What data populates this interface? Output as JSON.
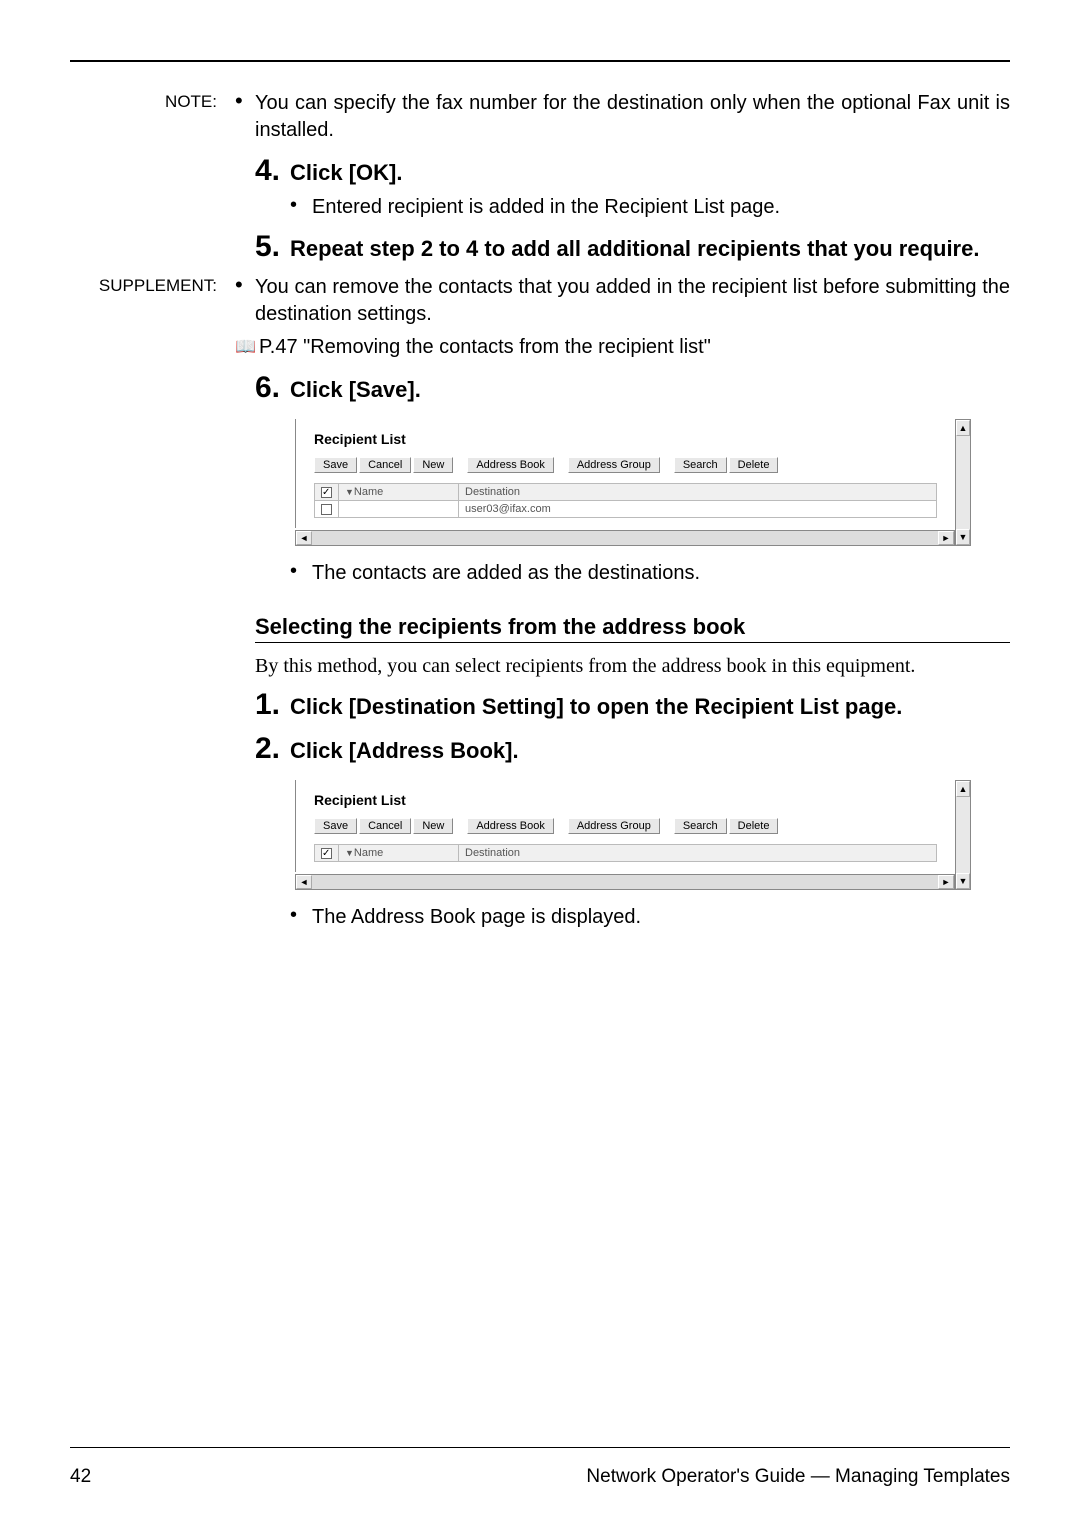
{
  "note_label": "NOTE:",
  "note_text": "You can specify the fax number for the destination only when the optional Fax unit is installed.",
  "step4": {
    "num": "4.",
    "text": "Click [OK]."
  },
  "step4_sub": "Entered recipient is added in the Recipient List page.",
  "step5": {
    "num": "5.",
    "text": "Repeat step 2 to 4 to add all additional recipients that you require."
  },
  "supp_label": "SUPPLEMENT:",
  "supp_text": "You can remove the contacts that you added in the recipient list before submitting the destination settings.",
  "supp_ref": "P.47 \"Removing the contacts from the recipient list\"",
  "step6": {
    "num": "6.",
    "text": "Click [Save]."
  },
  "step6_sub": "The contacts are added as the destinations.",
  "shot1": {
    "title": "Recipient List",
    "buttons": [
      "Save",
      "Cancel",
      "New",
      "Address Book",
      "Address Group",
      "Search",
      "Delete"
    ],
    "cols": [
      "Name",
      "Destination"
    ],
    "row_dest": "user03@ifax.com"
  },
  "heading3": "Selecting the recipients from the address book",
  "body1": "By this method, you can select recipients from the address book in this equipment.",
  "step1b": {
    "num": "1.",
    "text": "Click [Destination Setting] to open the Recipient List page."
  },
  "step2b": {
    "num": "2.",
    "text": "Click [Address Book]."
  },
  "shot2": {
    "title": "Recipient List",
    "buttons": [
      "Save",
      "Cancel",
      "New",
      "Address Book",
      "Address Group",
      "Search",
      "Delete"
    ],
    "cols": [
      "Name",
      "Destination"
    ]
  },
  "body2": "The Address Book page is displayed.",
  "footer": {
    "page": "42",
    "title": "Network Operator's Guide — Managing Templates"
  }
}
